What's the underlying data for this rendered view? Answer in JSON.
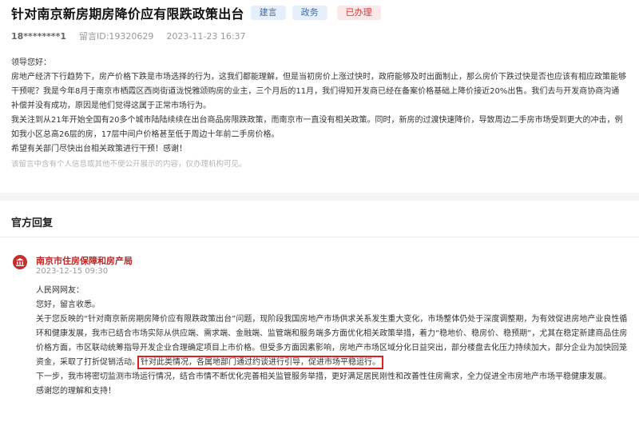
{
  "header": {
    "title": "针对南京新房期房降价应有限跌政策出台",
    "tags": [
      "建言",
      "政务",
      "已办理"
    ],
    "user": "18********1",
    "message_id": "留言ID:19320629",
    "time": "2023-11-23 16:37"
  },
  "letter": {
    "greeting": "领导您好：",
    "p1": "房地产经济下行趋势下，房产价格下跌是市场选择的行为，这我们都能理解，但是当初房价上涨过快时，政府能够及时出面制止，那么房价下跌过快是否也应该有相应政策能够干预呢？我是今年8月于南京市栖霞区西岗街道泷悦雅颂购房的业主，三个月后的11月，我们得知开发商已经在备案价格基础上降价接近20%出售。我们去与开发商协商沟通补偿并没有成功，原因是他们觉得这属于正常市场行为。",
    "p2": "我关注到从21年开始全国有20多个城市陆陆续续在出台商品房限跌政策，而南京市一直没有相关政策。同时，新房的过渡快速降价，导致周边二手房市场受到更大的冲击，例如我小区总高26层的房，17层中间户价格甚至低于周边十年前二手房价格。",
    "p3": "希望有关部门尽快出台相关政策进行干预！感谢！",
    "note": "该留言中含有个人信息或其他不便公开展示的内容，仅办理机构可见。"
  },
  "reply": {
    "heading": "官方回复",
    "org": "南京市住房保障和房产局",
    "date": "2023-12-15 09:30",
    "salutation": "人民网网友：",
    "hello": "您好，留言收悉。",
    "body_start": "关于您反映的“针对南京新房期房降价应有限跌政策出台”问题，现阶段我国房地产市场供求关系发生重大变化，市场整体仍处于深度调整期，为有效促进房地产业良性循环和健康发展，我市已结合市场实际从供应端、需求端、金融端、监管端和服务端多方面优化相关政策举措，着力“稳地价、稳房价、稳预期”，尤其在稳定新建商品住房价格方面，市区联动统筹指导开发企业合理确定项目上市价格。但受多方面因素影响，房地产市场区域分化日益突出，部分楼盘去化压力持续加大，部分企业为加快回笼资金，采取了打折促销活动。",
    "body_highlight": "针对此类情况，各属地部门通过约谈进行引导，促进市场平稳运行。",
    "next_step": "下一步，我市将密切监测市场运行情况，结合市情不断优化完善相关监管服务举措，更好满足居民刚性和改善性住房需求，全力促进全市房地产市场平稳健康发展。",
    "thanks": "感谢您的理解和支持！"
  },
  "colors": {
    "tag_blue_bg": "#e6effa",
    "tag_blue_text": "#3a6fb0",
    "tag_red_bg": "#fbe8e8",
    "tag_red_text": "#d23a3a",
    "org_red": "#b22a2a",
    "highlight_box": "#e02020"
  },
  "icons": {
    "org": "government-building-icon"
  }
}
